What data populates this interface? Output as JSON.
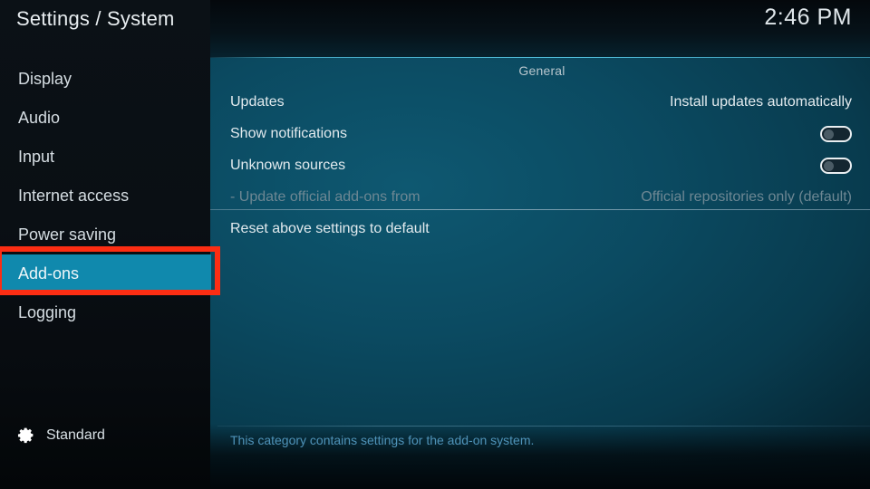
{
  "header": {
    "title": "Settings / System",
    "clock": "2:46 PM"
  },
  "sidebar": {
    "items": [
      {
        "label": "Display",
        "selected": false
      },
      {
        "label": "Audio",
        "selected": false
      },
      {
        "label": "Input",
        "selected": false
      },
      {
        "label": "Internet access",
        "selected": false
      },
      {
        "label": "Power saving",
        "selected": false
      },
      {
        "label": "Add-ons",
        "selected": true
      },
      {
        "label": "Logging",
        "selected": false
      }
    ],
    "profile": {
      "icon": "gear-icon",
      "label": "Standard"
    }
  },
  "main": {
    "group_title": "General",
    "rows": [
      {
        "label": "Updates",
        "value": "Install updates automatically",
        "type": "value",
        "dim": false
      },
      {
        "label": "Show notifications",
        "value": "off",
        "type": "toggle",
        "dim": false
      },
      {
        "label": "Unknown sources",
        "value": "off",
        "type": "toggle",
        "dim": false
      },
      {
        "label": "- Update official add-ons from",
        "value": "Official repositories only (default)",
        "type": "value",
        "dim": true
      },
      {
        "label": "Reset above settings to default",
        "value": "",
        "type": "value",
        "dim": false
      }
    ],
    "description": "This category contains settings for the add-on system."
  },
  "annotation": {
    "type": "highlight-rectangle",
    "target": "sidebar-item-add-ons",
    "color": "#fc2d13"
  },
  "colors": {
    "accent": "#1089ad",
    "annotation": "#fc2d13",
    "panel_teal": "#0b4a61",
    "sidebar": "#0a0f14",
    "description_text": "#4f93b9"
  }
}
